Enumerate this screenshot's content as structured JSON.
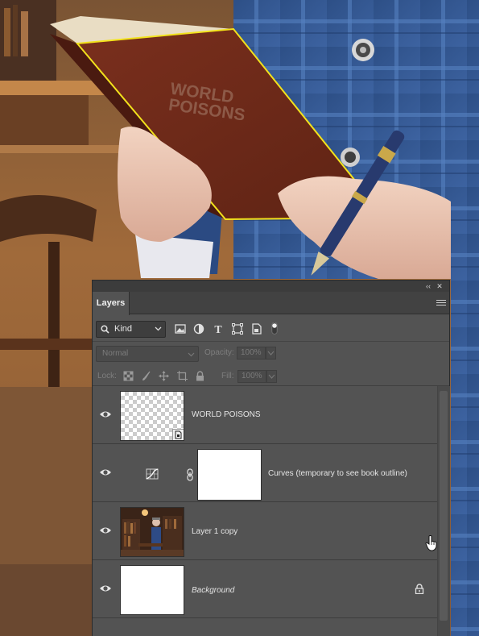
{
  "canvas": {
    "book_title_line1": "WORLD",
    "book_title_line2": "POISONS",
    "selection_color": "#f2e21c"
  },
  "panel": {
    "tab_label": "Layers",
    "collapse_icon": "double-chevron-left-icon",
    "close_icon": "close-icon",
    "menu_icon": "hamburger-icon",
    "filter": {
      "kind_label": "Kind",
      "icons": [
        "image-filter-icon",
        "adjustment-filter-icon",
        "type-filter-icon",
        "shape-filter-icon",
        "smart-object-filter-icon",
        "filter-toggle-icon"
      ]
    },
    "blend_mode": "Normal",
    "opacity_label": "Opacity:",
    "opacity_value": "100%",
    "lock_label": "Lock:",
    "fill_label": "Fill:",
    "fill_value": "100%"
  },
  "layers": [
    {
      "name": "WORLD POISONS",
      "type": "smart-object",
      "visible": true
    },
    {
      "name": "Curves (temporary to see book outline)",
      "type": "adjustment-curves",
      "visible": true
    },
    {
      "name": "Layer 1 copy",
      "type": "pixel",
      "visible": true
    },
    {
      "name": "Background",
      "type": "background",
      "visible": true,
      "locked": true
    }
  ],
  "colors": {
    "panel_bg": "#535353",
    "panel_header": "#424242",
    "accent_selection": "#f2e21c"
  }
}
